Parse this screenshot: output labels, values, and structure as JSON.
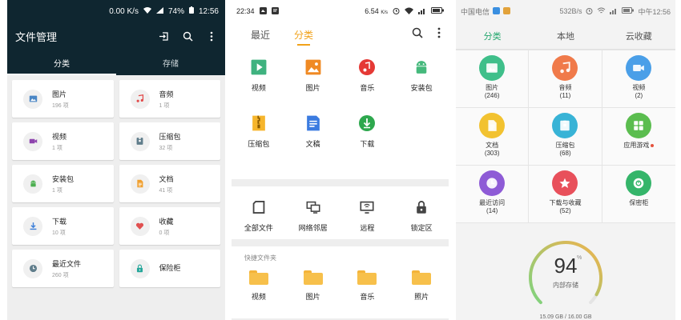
{
  "phone1": {
    "status": {
      "speed": "0.00 K/s",
      "battery": "74%",
      "time": "12:56"
    },
    "title": "文件管理",
    "tabs": [
      "分类",
      "存储"
    ],
    "items": [
      {
        "name": "图片",
        "count": "196 项",
        "icon": "image-icon",
        "color": "#4a86c5"
      },
      {
        "name": "音频",
        "count": "1 项",
        "icon": "music-icon",
        "color": "#e24b4b"
      },
      {
        "name": "视频",
        "count": "1 项",
        "icon": "video-icon",
        "color": "#8e44ad"
      },
      {
        "name": "压缩包",
        "count": "32 项",
        "icon": "archive-icon",
        "color": "#607d8b"
      },
      {
        "name": "安装包",
        "count": "1 项",
        "icon": "android-icon",
        "color": "#4caf50"
      },
      {
        "name": "文档",
        "count": "41 项",
        "icon": "document-icon",
        "color": "#f0a030"
      },
      {
        "name": "下载",
        "count": "10 项",
        "icon": "download-icon",
        "color": "#3d7fd8"
      },
      {
        "name": "收藏",
        "count": "0 项",
        "icon": "heart-icon",
        "color": "#e05050"
      },
      {
        "name": "最近文件",
        "count": "260 项",
        "icon": "clock-icon",
        "color": "#607d8b"
      },
      {
        "name": "保险柜",
        "count": "",
        "icon": "lock-icon",
        "color": "#26a69a"
      }
    ]
  },
  "phone2": {
    "status": {
      "time": "22:34",
      "speed": "6.54",
      "speed_unit": "K/s"
    },
    "tabs": [
      "最近",
      "分类"
    ],
    "categories": [
      {
        "label": "视频",
        "icon": "play-icon",
        "color": "#3fb27f"
      },
      {
        "label": "图片",
        "icon": "picture-icon",
        "color": "#f08a24"
      },
      {
        "label": "音乐",
        "icon": "music-icon",
        "color": "#e53935"
      },
      {
        "label": "安装包",
        "icon": "android-icon",
        "color": "#45b97c"
      },
      {
        "label": "压缩包",
        "icon": "zip-icon",
        "color": "#f6b52c"
      },
      {
        "label": "文稿",
        "icon": "doc-icon",
        "color": "#3b7be0"
      },
      {
        "label": "下载",
        "icon": "download-icon",
        "color": "#2ea84e"
      }
    ],
    "locations": [
      {
        "label": "全部文件",
        "icon": "sdcard-icon"
      },
      {
        "label": "网络邻居",
        "icon": "network-icon"
      },
      {
        "label": "远程",
        "icon": "remote-icon"
      },
      {
        "label": "锁定区",
        "icon": "lock-icon"
      }
    ],
    "quick_header": "快捷文件夹",
    "folders": [
      "视频",
      "图片",
      "音乐",
      "照片"
    ]
  },
  "phone3": {
    "status": {
      "carrier": "中国电信",
      "speed": "532B/s",
      "time": "中午12:56"
    },
    "tabs": [
      "分类",
      "本地",
      "云收藏"
    ],
    "items": [
      {
        "label": "图片",
        "count": "(246)",
        "icon": "image-icon",
        "color": "#3fbf8a"
      },
      {
        "label": "音频",
        "count": "(11)",
        "icon": "music-icon",
        "color": "#f07a4a"
      },
      {
        "label": "视频",
        "count": "(2)",
        "icon": "video-icon",
        "color": "#4a9fe8"
      },
      {
        "label": "文档",
        "count": "(303)",
        "icon": "document-icon",
        "color": "#f2c230"
      },
      {
        "label": "压缩包",
        "count": "(68)",
        "icon": "archive-icon",
        "color": "#38b3d6"
      },
      {
        "label": "应用游戏",
        "count": "",
        "icon": "apps-icon",
        "color": "#5bbd4f"
      },
      {
        "label": "最近访问",
        "count": "(14)",
        "icon": "clock-icon",
        "color": "#8e5bd6"
      },
      {
        "label": "下载与收藏",
        "count": "(52)",
        "icon": "star-icon",
        "color": "#e8505b"
      },
      {
        "label": "保密柜",
        "count": "",
        "icon": "safe-icon",
        "color": "#35b56a"
      }
    ],
    "storage": {
      "percent": "94",
      "percent_sign": "%",
      "label": "内部存储",
      "size": "15.09 GB / 16.00 GB",
      "fill": 0.94
    }
  }
}
